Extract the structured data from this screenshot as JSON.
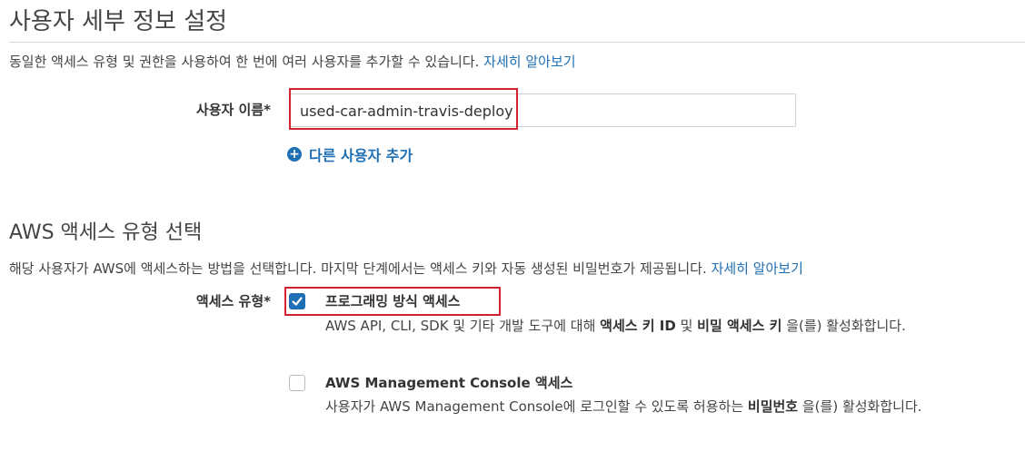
{
  "details": {
    "title": "사용자 세부 정보 설정",
    "description": "동일한 액세스 유형 및 권한을 사용하여 한 번에 여러 사용자를 추가할 수 있습니다.",
    "learn_more": "자세히 알아보기"
  },
  "username": {
    "label": "사용자 이름*",
    "value": "used-car-admin-travis-deploy"
  },
  "add_user": {
    "icon": "plus-circle-icon",
    "label": "다른 사용자 추가"
  },
  "access": {
    "title": "AWS 액세스 유형 선택",
    "description": "해당 사용자가 AWS에 액세스하는 방법을 선택합니다. 마지막 단계에서는 액세스 키와 자동 생성된 비밀번호가 제공됩니다.",
    "learn_more": "자세히 알아보기",
    "label": "액세스 유형*",
    "options": [
      {
        "title": "프로그래밍 방식 액세스",
        "checked": true,
        "desc_1": "AWS API, CLI, SDK 및 기타 개발 도구에 대해 ",
        "desc_bold_1": "액세스 키 ID",
        "desc_2": " 및 ",
        "desc_bold_2": "비밀 액세스 키",
        "desc_3": " 을(를) 활성화합니다."
      },
      {
        "title": "AWS Management Console 액세스",
        "checked": false,
        "desc_1": "사용자가 AWS Management Console에 로그인할 수 있도록 허용하는 ",
        "desc_bold_1": "비밀번호",
        "desc_2": " 을(를) 활성화합니다."
      }
    ]
  },
  "colors": {
    "link": "#1f6fb5",
    "highlight": "#d2222d"
  }
}
